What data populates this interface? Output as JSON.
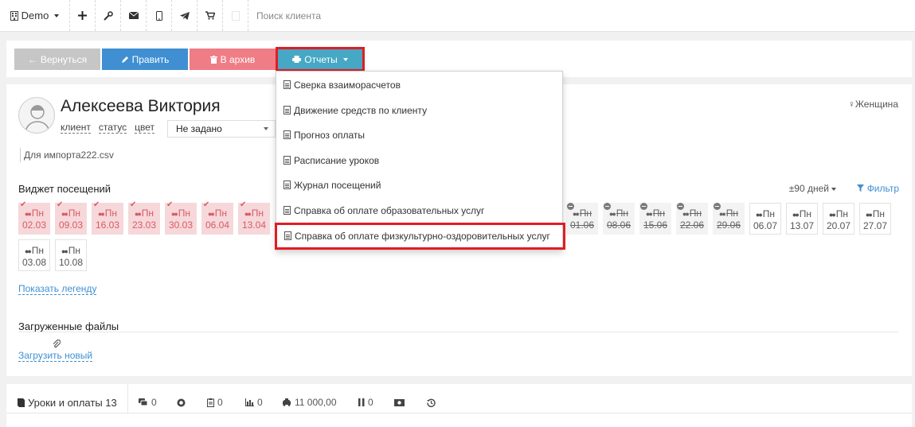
{
  "topbar": {
    "account": "Demo",
    "icons": [
      "plus-icon",
      "wrench-icon",
      "mail-icon",
      "phone-icon",
      "telegram-icon",
      "cart-icon",
      "blank-icon"
    ],
    "search_placeholder": "Поиск клиента"
  },
  "actions": {
    "back": "Вернуться",
    "edit": "Править",
    "archive": "В архив",
    "reports": "Отчеты"
  },
  "client": {
    "name": "Алексеева Виктория",
    "links": [
      "клиент",
      "статус",
      "цвет"
    ],
    "status_value": "Не задано",
    "gender": "Женщина",
    "note": "Для импорта222.csv"
  },
  "visits_widget": {
    "title": "Виджет посещений",
    "range": "±90 дней",
    "filter": "Фильтр",
    "visits": [
      {
        "weekday": "Пн",
        "date": "02.03",
        "state": "paid"
      },
      {
        "weekday": "Пн",
        "date": "09.03",
        "state": "paid"
      },
      {
        "weekday": "Пн",
        "date": "16.03",
        "state": "paid"
      },
      {
        "weekday": "Пн",
        "date": "23.03",
        "state": "paid"
      },
      {
        "weekday": "Пн",
        "date": "30.03",
        "state": "paid"
      },
      {
        "weekday": "Пн",
        "date": "06.04",
        "state": "paid"
      },
      {
        "weekday": "Пн",
        "date": "13.04",
        "state": "paid"
      },
      {
        "weekday": "Пн",
        "date": "01.06",
        "state": "cancelled"
      },
      {
        "weekday": "Пн",
        "date": "08.06",
        "state": "cancelled"
      },
      {
        "weekday": "Пн",
        "date": "15.06",
        "state": "cancelled"
      },
      {
        "weekday": "Пн",
        "date": "22.06",
        "state": "cancelled"
      },
      {
        "weekday": "Пн",
        "date": "29.06",
        "state": "cancelled"
      },
      {
        "weekday": "Пн",
        "date": "06.07",
        "state": "open"
      },
      {
        "weekday": "Пн",
        "date": "13.07",
        "state": "open"
      },
      {
        "weekday": "Пн",
        "date": "20.07",
        "state": "open"
      },
      {
        "weekday": "Пн",
        "date": "27.07",
        "state": "open"
      },
      {
        "weekday": "Пн",
        "date": "03.08",
        "state": "open"
      },
      {
        "weekday": "Пн",
        "date": "10.08",
        "state": "open"
      }
    ],
    "show_legend": "Показать легенду"
  },
  "files": {
    "title": "Загруженные файлы",
    "upload": "Загрузить новый"
  },
  "tabs": [
    {
      "icon": "book-icon",
      "label": "Уроки и оплаты 13"
    },
    {
      "icon": "comments-icon",
      "label": "0"
    },
    {
      "icon": "whatsapp-icon",
      "label": ""
    },
    {
      "icon": "clipboard-icon",
      "label": "0"
    },
    {
      "icon": "bar-chart-icon",
      "label": "0"
    },
    {
      "icon": "taxi-icon",
      "label": "11 000,00"
    },
    {
      "icon": "pause-icon",
      "label": "0"
    },
    {
      "icon": "money-icon",
      "label": ""
    },
    {
      "icon": "history-icon",
      "label": ""
    }
  ],
  "reports_menu": {
    "items": [
      "Сверка взаиморасчетов",
      "Движение средств по клиенту",
      "Прогноз оплаты",
      "Расписание уроков",
      "Журнал посещений",
      "Справка об оплате образовательных услуг",
      "Справка об оплате физкультурно-оздоровительных услуг"
    ],
    "highlighted_index": 6
  },
  "colors": {
    "accent_blue": "#3f8fd2",
    "reports_teal": "#46a8c4",
    "archive_pink": "#ef7d86",
    "highlight_red": "#e21c24",
    "paid_bg": "#f6d8da"
  }
}
